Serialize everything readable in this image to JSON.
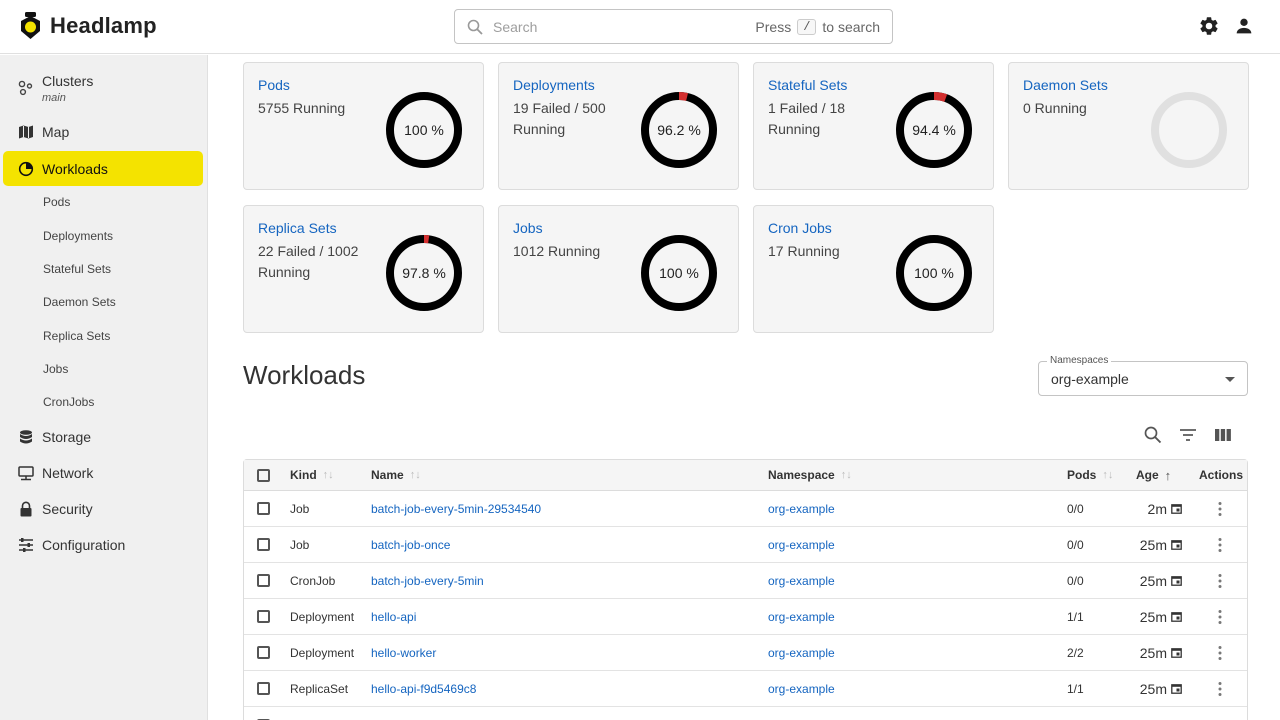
{
  "app": {
    "name": "Headlamp"
  },
  "search": {
    "placeholder": "Search",
    "hint_prefix": "Press",
    "hint_key": "/",
    "hint_suffix": "to search"
  },
  "topbar": {
    "settings_icon": "gear-icon",
    "user_icon": "account-icon"
  },
  "sidebar": {
    "items": [
      {
        "label": "Clusters",
        "sub": "main",
        "icon": "clusters-icon"
      },
      {
        "label": "Map",
        "icon": "map-icon"
      },
      {
        "label": "Workloads",
        "icon": "workloads-icon",
        "active": true
      },
      {
        "label": "Storage",
        "icon": "storage-icon"
      },
      {
        "label": "Network",
        "icon": "network-icon"
      },
      {
        "label": "Security",
        "icon": "lock-icon"
      },
      {
        "label": "Configuration",
        "icon": "configuration-icon"
      }
    ],
    "subitems": [
      "Pods",
      "Deployments",
      "Stateful Sets",
      "Daemon Sets",
      "Replica Sets",
      "Jobs",
      "CronJobs"
    ],
    "active_color": "#f4e300"
  },
  "cards": [
    {
      "title": "Pods",
      "desc": "5755 Running",
      "percent_label": "100 %",
      "failed_fraction": 0
    },
    {
      "title": "Deployments",
      "desc": "19 Failed / 500 Running",
      "percent_label": "96.2 %",
      "failed_fraction": 0.038
    },
    {
      "title": "Stateful Sets",
      "desc": "1 Failed / 18 Running",
      "percent_label": "94.4 %",
      "failed_fraction": 0.056
    },
    {
      "title": "Daemon Sets",
      "desc": "0 Running",
      "percent_label": "",
      "failed_fraction": 0,
      "empty": true
    },
    {
      "title": "Replica Sets",
      "desc": "22 Failed / 1002 Running",
      "percent_label": "97.8 %",
      "failed_fraction": 0.022
    },
    {
      "title": "Jobs",
      "desc": "1012 Running",
      "percent_label": "100 %",
      "failed_fraction": 0
    },
    {
      "title": "Cron Jobs",
      "desc": "17 Running",
      "percent_label": "100 %",
      "failed_fraction": 0
    }
  ],
  "colors": {
    "ok": "#000000",
    "failed": "#d32f2f",
    "empty": "#e0e0e0",
    "link": "#1565c0"
  },
  "workloads": {
    "title": "Workloads",
    "namespace_label": "Namespaces",
    "namespace_value": "org-example",
    "toolbar_icons": [
      "search-icon",
      "filter-icon",
      "columns-icon"
    ]
  },
  "table": {
    "columns": [
      "Kind",
      "Name",
      "Namespace",
      "Pods",
      "Age",
      "Actions"
    ],
    "rows": [
      {
        "kind": "Job",
        "name": "batch-job-every-5min-29534540",
        "namespace": "org-example",
        "pods": "0/0",
        "age": "2m"
      },
      {
        "kind": "Job",
        "name": "batch-job-once",
        "namespace": "org-example",
        "pods": "0/0",
        "age": "25m"
      },
      {
        "kind": "CronJob",
        "name": "batch-job-every-5min",
        "namespace": "org-example",
        "pods": "0/0",
        "age": "25m"
      },
      {
        "kind": "Deployment",
        "name": "hello-api",
        "namespace": "org-example",
        "pods": "1/1",
        "age": "25m"
      },
      {
        "kind": "Deployment",
        "name": "hello-worker",
        "namespace": "org-example",
        "pods": "2/2",
        "age": "25m"
      },
      {
        "kind": "ReplicaSet",
        "name": "hello-api-f9d5469c8",
        "namespace": "org-example",
        "pods": "1/1",
        "age": "25m"
      }
    ]
  }
}
